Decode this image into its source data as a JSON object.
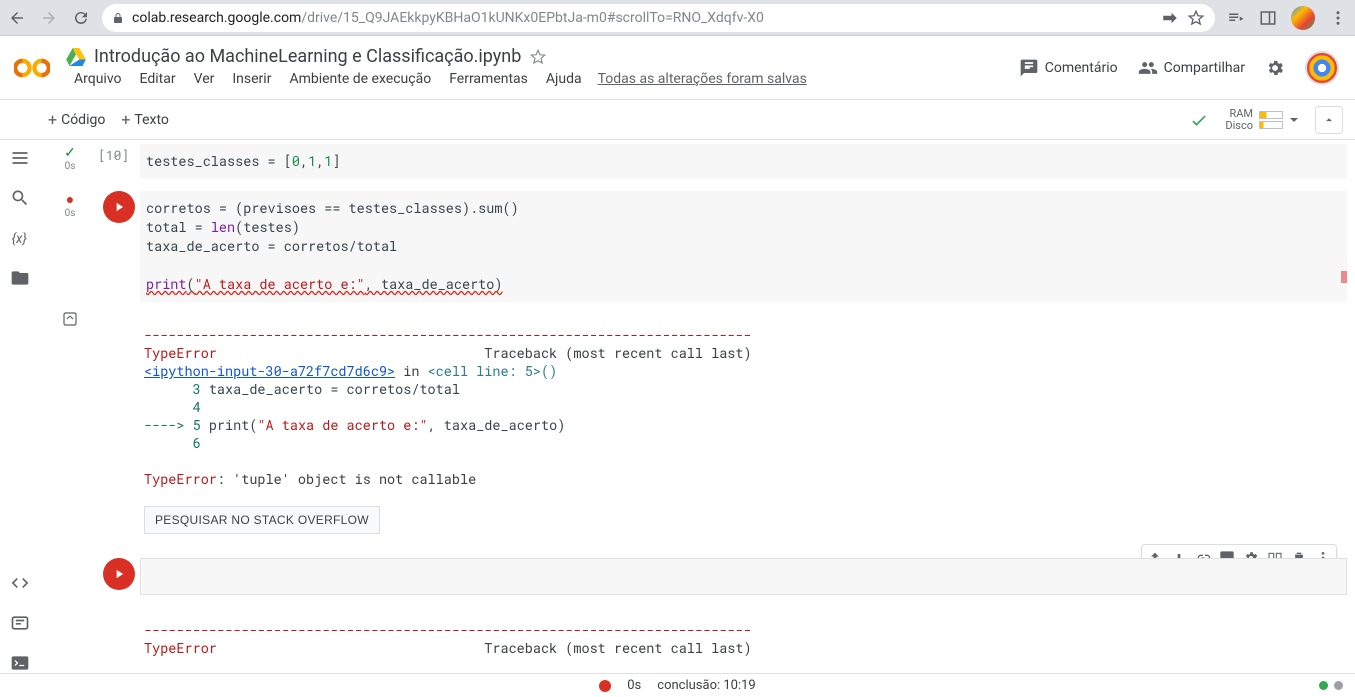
{
  "browser": {
    "url_host": "colab.research.google.com",
    "url_path": "/drive/15_Q9JAEkkpyKBHaO1kUNKx0EPbtJa-m0#scrollTo=RNO_Xdqfv-X0"
  },
  "header": {
    "title": "Introdução ao MachineLearning e Classificação.ipynb",
    "menus": [
      "Arquivo",
      "Editar",
      "Ver",
      "Inserir",
      "Ambiente de execução",
      "Ferramentas",
      "Ajuda"
    ],
    "save_status": "Todas as alterações foram salvas",
    "comment": "Comentário",
    "share": "Compartilhar"
  },
  "toolbar": {
    "code": "Código",
    "text": "Texto",
    "ram": "RAM",
    "disk": "Disco"
  },
  "cells": {
    "c0": {
      "status_time": "0s",
      "exec_count": "[10]",
      "code": "testes_classes = [0,1,1]"
    },
    "c1": {
      "status_time": "0s",
      "so_button": "PESQUISAR NO STACK OVERFLOW"
    },
    "traceback": {
      "dashes": "---------------------------------------------------------------------------",
      "err_name": "TypeError",
      "trace_head": "                                 Traceback (most recent call last)",
      "link": "<ipython-input-30-a72f7cd7d6c9>",
      "in_word": " in ",
      "cell_ref": "<cell line: 5>",
      "paren": "()",
      "l3_num": "      3",
      "l3_code": " taxa_de_acerto = corretos/total",
      "l4_num": "      4",
      "l5_arrow": "----> ",
      "l5_num": "5",
      "l5_code_a": " print(",
      "l5_code_str": "\"A taxa de acerto e:\"",
      "l5_code_b": ", taxa_de_acerto)",
      "l6_num": "      6",
      "final": "TypeError",
      "final_msg": ": 'tuple' object is not callable"
    },
    "traceback2": {
      "dashes": "---------------------------------------------------------------------------",
      "err_name": "TypeError",
      "trace_head": "                                 Traceback (most recent call last)"
    }
  },
  "status": {
    "time": "0s",
    "completed": "conclusão: 10:19"
  }
}
